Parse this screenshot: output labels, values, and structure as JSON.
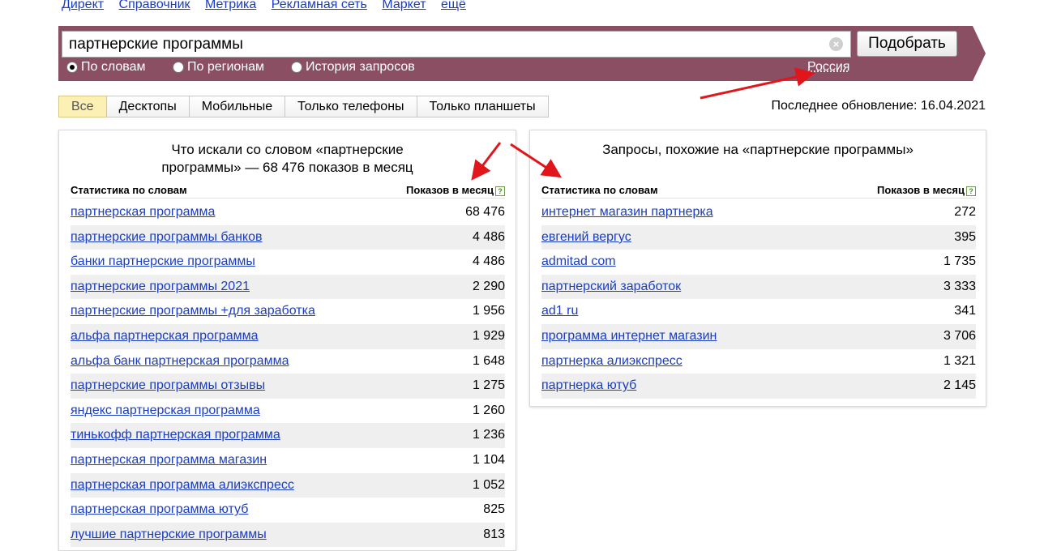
{
  "topnav": [
    "Директ",
    "Справочник",
    "Метрика",
    "Рекламная сеть",
    "Маркет",
    "ещё"
  ],
  "search": {
    "value": "партнерские программы",
    "clear_icon": "×",
    "button": "Подобрать"
  },
  "radios": [
    {
      "label": "По словам",
      "checked": true
    },
    {
      "label": "По регионам",
      "checked": false
    },
    {
      "label": "История запросов",
      "checked": false
    }
  ],
  "region": "Россия",
  "tabs": [
    {
      "label": "Все",
      "active": true
    },
    {
      "label": "Десктопы",
      "active": false
    },
    {
      "label": "Мобильные",
      "active": false
    },
    {
      "label": "Только телефоны",
      "active": false
    },
    {
      "label": "Только планшеты",
      "active": false
    }
  ],
  "last_update": "Последнее обновление: 16.04.2021",
  "left_panel": {
    "title_line1": "Что искали со словом «партнерские",
    "title_line2": "программы» — 68 476 показов в месяц",
    "col_words": "Статистика по словам",
    "col_count": "Показов в месяц",
    "help": "?",
    "rows": [
      {
        "query": "партнерская программа",
        "count": "68 476"
      },
      {
        "query": "партнерские программы банков",
        "count": "4 486"
      },
      {
        "query": "банки партнерские программы",
        "count": "4 486"
      },
      {
        "query": "партнерские программы 2021",
        "count": "2 290"
      },
      {
        "query": "партнерские программы +для заработка",
        "count": "1 956"
      },
      {
        "query": "альфа партнерская программа",
        "count": "1 929"
      },
      {
        "query": "альфа банк партнерская программа",
        "count": "1 648"
      },
      {
        "query": "партнерские программы отзывы",
        "count": "1 275"
      },
      {
        "query": "яндекс партнерская программа",
        "count": "1 260"
      },
      {
        "query": "тинькофф партнерская программа",
        "count": "1 236"
      },
      {
        "query": "партнерская программа магазин",
        "count": "1 104"
      },
      {
        "query": "партнерская программа алиэкспресс",
        "count": "1 052"
      },
      {
        "query": "партнерская программа ютуб",
        "count": "825"
      },
      {
        "query": "лучшие партнерские программы",
        "count": "813"
      }
    ]
  },
  "right_panel": {
    "title": "Запросы, похожие на «партнерские программы»",
    "col_words": "Статистика по словам",
    "col_count": "Показов в месяц",
    "help": "?",
    "rows": [
      {
        "query": "интернет магазин партнерка",
        "count": "272"
      },
      {
        "query": "евгений вергус",
        "count": "395"
      },
      {
        "query": "admitad com",
        "count": "1 735"
      },
      {
        "query": "партнерский заработок",
        "count": "3 333"
      },
      {
        "query": "ad1 ru",
        "count": "341"
      },
      {
        "query": "программа интернет магазин",
        "count": "3 706"
      },
      {
        "query": "партнерка алиэкспресс",
        "count": "1 321"
      },
      {
        "query": "партнерка ютуб",
        "count": "2 145"
      }
    ]
  },
  "colors": {
    "bar": "#8b4f64",
    "link": "#1a3dc1",
    "active_tab": "#fdf0b4",
    "arrow": "#e0161b"
  }
}
